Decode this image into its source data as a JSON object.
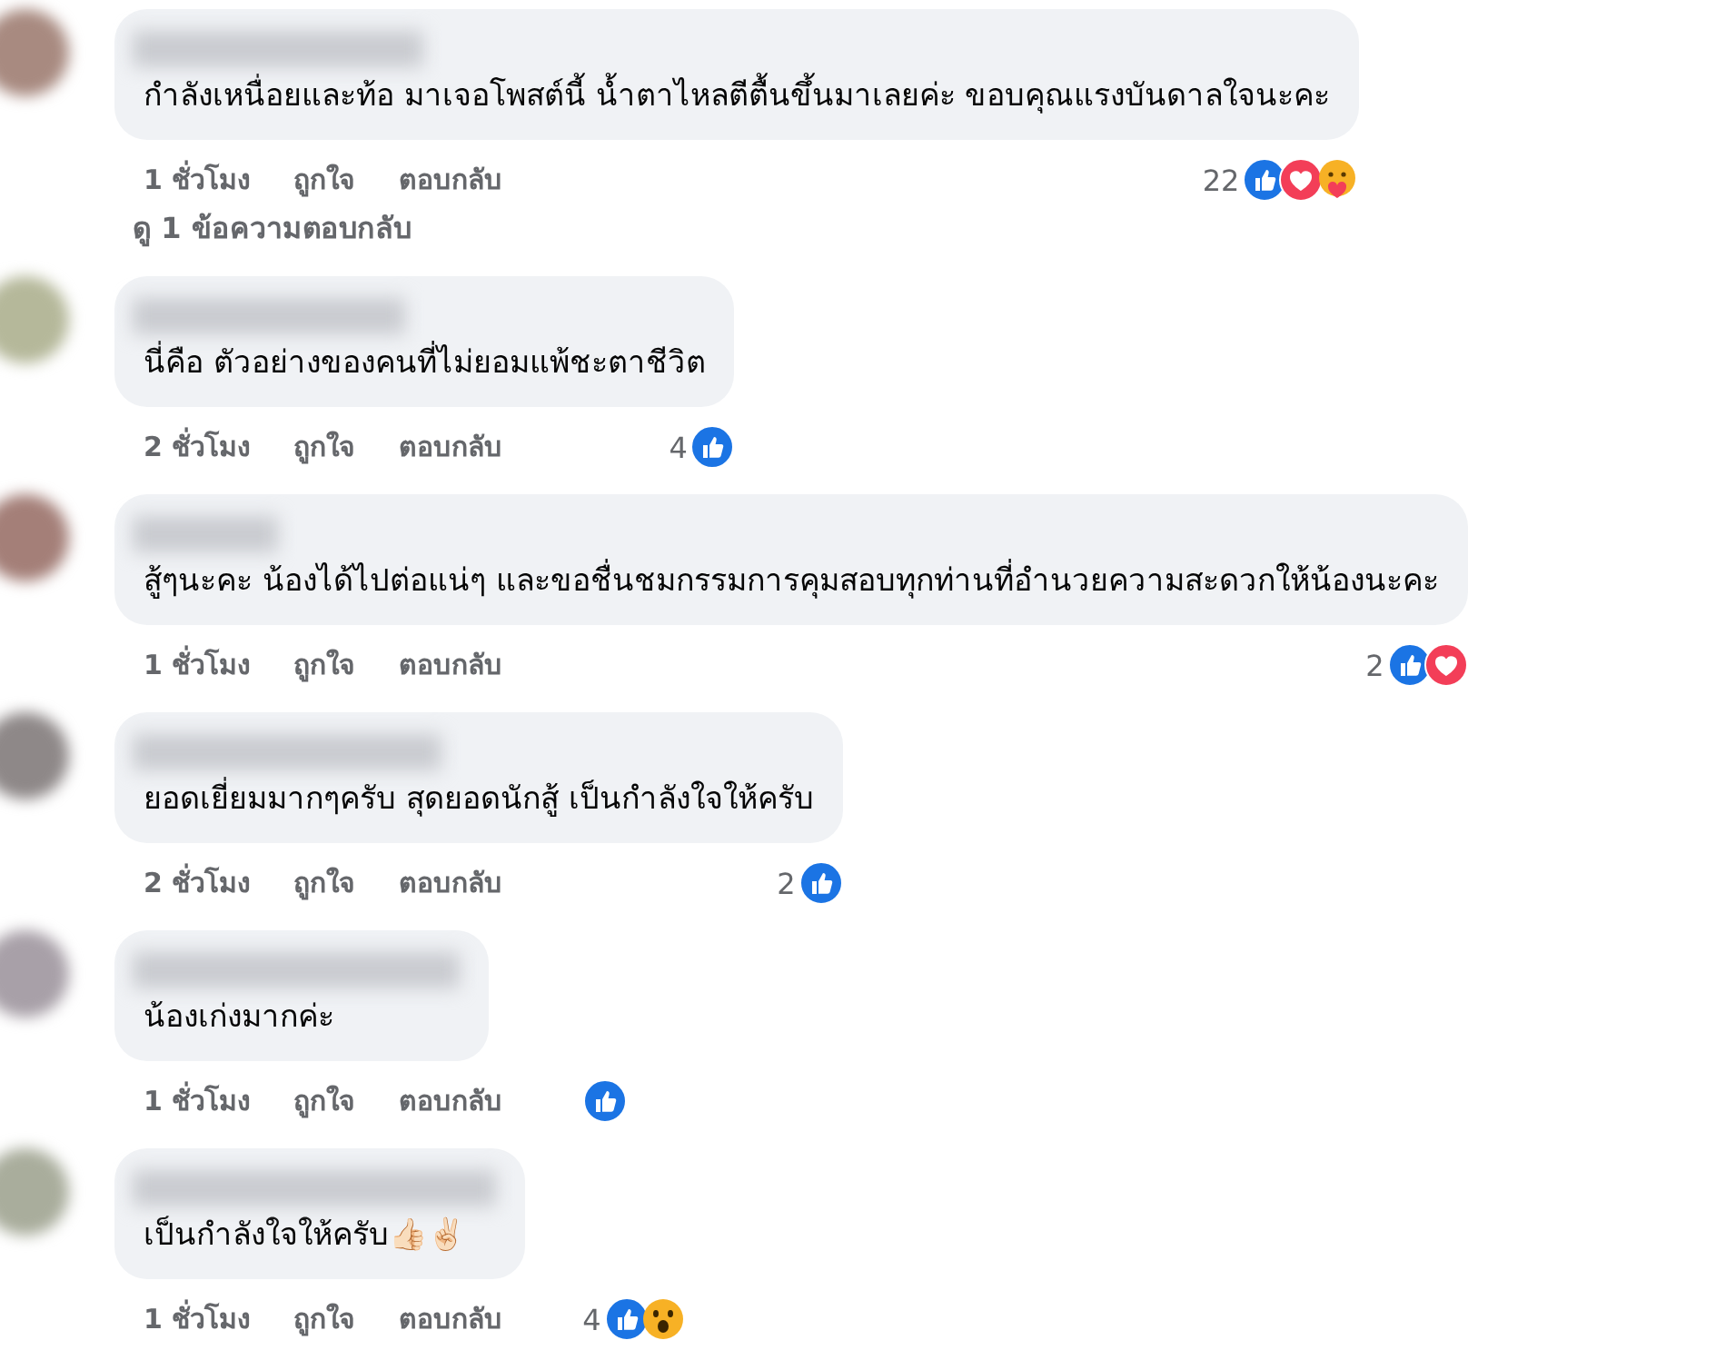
{
  "comments": [
    {
      "text": "กำลังเหนื่อยและท้อ มาเจอโพสต์นี้ น้ำตาไหลตีตื้นขึ้นมาเลยค่ะ ขอบคุณแรงบันดาลใจนะคะ",
      "time": "1 ชั่วโมง",
      "like": "ถูกใจ",
      "reply": "ตอบกลับ",
      "reaction_count": "22",
      "reactions": [
        {
          "kind": "like"
        },
        {
          "kind": "love"
        },
        {
          "kind": "care"
        }
      ],
      "replies_link": "ดู 1 ข้อความตอบกลับ"
    },
    {
      "text": "นี่คือ ตัวอย่างของคนที่ไม่ยอมแพ้ชะตาชีวิต",
      "time": "2 ชั่วโมง",
      "like": "ถูกใจ",
      "reply": "ตอบกลับ",
      "reaction_count": "4",
      "reactions": [
        {
          "kind": "like"
        }
      ]
    },
    {
      "text": "สู้ๆนะคะ น้องได้ไปต่อแน่ๆ และขอชื่นชมกรรมการคุมสอบทุกท่านที่อำนวยความสะดวกให้น้องนะคะ",
      "time": "1 ชั่วโมง",
      "like": "ถูกใจ",
      "reply": "ตอบกลับ",
      "reaction_count": "2",
      "reactions": [
        {
          "kind": "like"
        },
        {
          "kind": "love"
        }
      ]
    },
    {
      "text": "ยอดเยี่ยมมากๆครับ สุดยอดนักสู้ เป็นกำลังใจให้ครับ",
      "time": "2 ชั่วโมง",
      "like": "ถูกใจ",
      "reply": "ตอบกลับ",
      "reaction_count": "2",
      "reactions": [
        {
          "kind": "like"
        }
      ]
    },
    {
      "text": "น้องเก่งมากค่ะ",
      "time": "1 ชั่วโมง",
      "like": "ถูกใจ",
      "reply": "ตอบกลับ",
      "reactions": [
        {
          "kind": "like"
        }
      ]
    },
    {
      "text": "เป็นกำลังใจให้ครับ👍🏻✌🏻",
      "time": "1 ชั่วโมง",
      "like": "ถูกใจ",
      "reply": "ตอบกลับ",
      "reaction_count": "4",
      "reactions": [
        {
          "kind": "like"
        },
        {
          "kind": "wow"
        }
      ]
    }
  ]
}
